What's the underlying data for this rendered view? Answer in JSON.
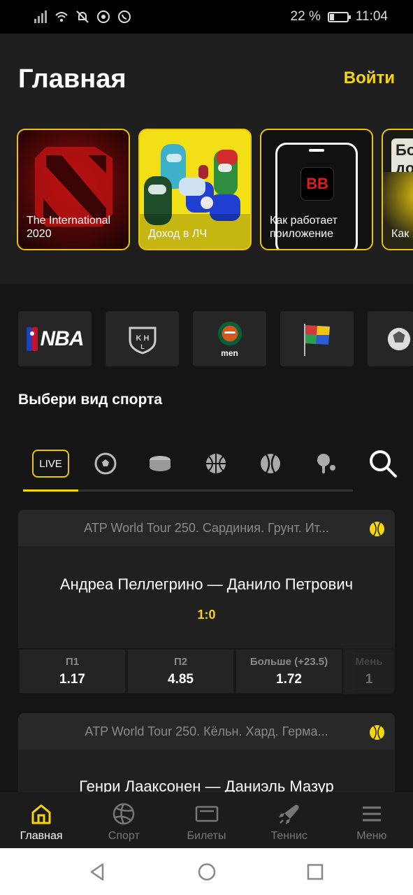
{
  "status_bar": {
    "battery": "22 %",
    "time": "11:04"
  },
  "header": {
    "title": "Главная",
    "login": "Войти"
  },
  "stories": [
    {
      "caption": "The International\n2020"
    },
    {
      "caption": "Доход в ЛЧ"
    },
    {
      "caption": "Как работает\nприложение",
      "logo": "BB"
    },
    {
      "caption": "Как",
      "badge_top": "Бо",
      "badge_bottom": "до"
    }
  ],
  "leagues": [
    {
      "name": "NBA"
    },
    {
      "name": "KHL"
    },
    {
      "name": "men"
    },
    {
      "name": "nations-league-flag-icon"
    },
    {
      "name": "ball-icon"
    }
  ],
  "section_title": "Выбери вид спорта",
  "sport_tabs": {
    "live_label": "LIVE"
  },
  "events": [
    {
      "league": "ATP World Tour 250. Сардиния. Грунт. Ит...",
      "teams": "Андреа Пеллегрино — Данило Петрович",
      "score": "1:0",
      "odds": [
        {
          "label": "П1",
          "value": "1.17"
        },
        {
          "label": "П2",
          "value": "4.85"
        },
        {
          "label": "Больше (+23.5)",
          "value": "1.72"
        },
        {
          "label": "Мень",
          "value": "1"
        }
      ]
    },
    {
      "league": "ATP World Tour 250. Кёльн. Хард. Герма...",
      "teams": "Генри Лааксонен — Даниэль Мазур"
    }
  ],
  "bottom_nav": [
    {
      "label": "Главная"
    },
    {
      "label": "Спорт"
    },
    {
      "label": "Билеты"
    },
    {
      "label": "Теннис"
    },
    {
      "label": "Меню"
    }
  ],
  "colors": {
    "accent": "#f5d50c",
    "background": "#151515",
    "card": "#202020"
  }
}
